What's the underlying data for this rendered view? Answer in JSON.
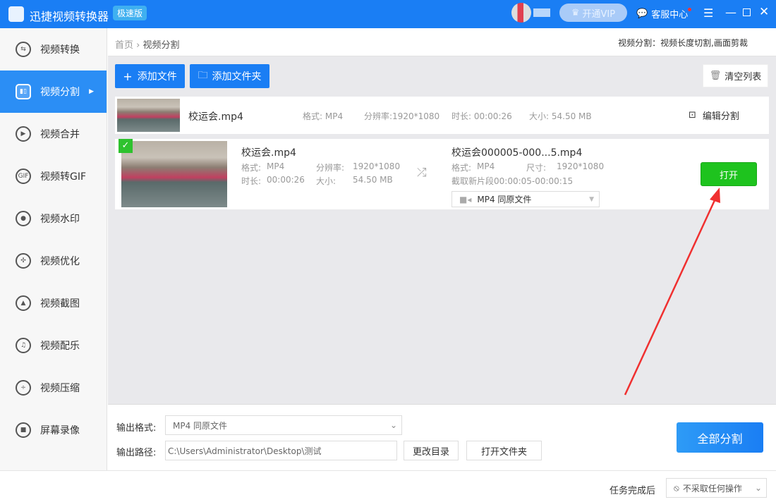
{
  "app": {
    "title": "迅捷视频转换器",
    "badge": "极速版",
    "vip": "开通VIP",
    "support": "客服中心"
  },
  "sidebar": {
    "items": [
      {
        "label": "视频转换",
        "icon": "⇆"
      },
      {
        "label": "视频分割",
        "icon": "▮▯"
      },
      {
        "label": "视频合并",
        "icon": "▶"
      },
      {
        "label": "视频转GIF",
        "icon": "GIF"
      },
      {
        "label": "视频水印",
        "icon": "●"
      },
      {
        "label": "视频优化",
        "icon": "✣"
      },
      {
        "label": "视频截图",
        "icon": "▲"
      },
      {
        "label": "视频配乐",
        "icon": "♫"
      },
      {
        "label": "视频压缩",
        "icon": "÷"
      },
      {
        "label": "屏幕录像",
        "icon": "■"
      }
    ]
  },
  "breadcrumb": {
    "home": "首页",
    "sep": "›",
    "current": "视频分割"
  },
  "hint": "视频分割：视频长度切割,画面剪裁",
  "toolbar": {
    "add_file": "添加文件",
    "add_folder": "添加文件夹",
    "clear": "清空列表"
  },
  "file": {
    "name": "校运会.mp4",
    "format": "格式: MP4",
    "resolution": "分辨率:1920*1080",
    "duration": "时长: 00:00:26",
    "size": "大小: 54.50 MB",
    "edit": "编辑分割"
  },
  "task": {
    "src_name": "校运会.mp4",
    "fmt_label": "格式:",
    "fmt": "MP4",
    "res_label": "分辨率:",
    "res": "1920*1080",
    "dur_label": "时长:",
    "dur": "00:00:26",
    "size_label": "大小:",
    "size": "54.50 MB",
    "out_name": "校运会000005-000...5.mp4",
    "out_fmt_label": "格式:",
    "out_fmt": "MP4",
    "out_dim_label": "尺寸:",
    "out_dim": "1920*1080",
    "segment": "截取新片段00:00:05-00:00:15",
    "out_select": "MP4  同原文件",
    "open": "打开"
  },
  "bottom": {
    "format_label": "输出格式:",
    "format_value": "MP4  同原文件",
    "path_label": "输出路径:",
    "path_value": "C:\\Users\\Administrator\\Desktop\\测试",
    "change_dir": "更改目录",
    "open_folder": "打开文件夹",
    "split_all": "全部分割"
  },
  "status": {
    "after_label": "任务完成后",
    "after_value": "不采取任何操作"
  },
  "colors": {
    "accent": "#1a7ef4",
    "open_button": "#1ec31e",
    "arrow": "#f03030"
  }
}
